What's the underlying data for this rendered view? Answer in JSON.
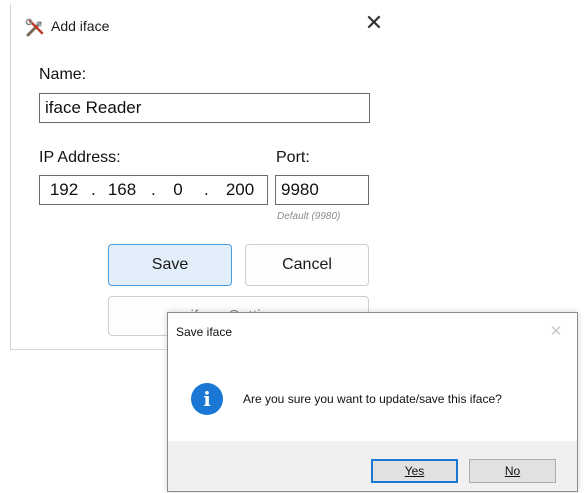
{
  "main_window": {
    "title": "Add iface",
    "close_glyph": "✕",
    "name_label": "Name:",
    "name_value": "iface Reader",
    "ip_label": "IP Address:",
    "ip_octets": [
      "192",
      "168",
      "0",
      "200"
    ],
    "ip_separator": ".",
    "port_label": "Port:",
    "port_value": "9980",
    "port_hint": "Default (9980)",
    "save_label": "Save",
    "cancel_label": "Cancel",
    "third_button_label": "iface Settings",
    "app_icon": "tools-icon"
  },
  "message_box": {
    "title": "Save iface",
    "close_glyph": "✕",
    "icon": "info-icon",
    "icon_glyph": "i",
    "message": "Are you sure you want to update/save this iface?",
    "yes_label": "Yes",
    "no_label": "No"
  },
  "colors": {
    "accent": "#1a78d4",
    "primary_button_bg": "#e2effa",
    "primary_button_border": "#4a9be0",
    "dialog_footer": "#f0f0f0"
  }
}
